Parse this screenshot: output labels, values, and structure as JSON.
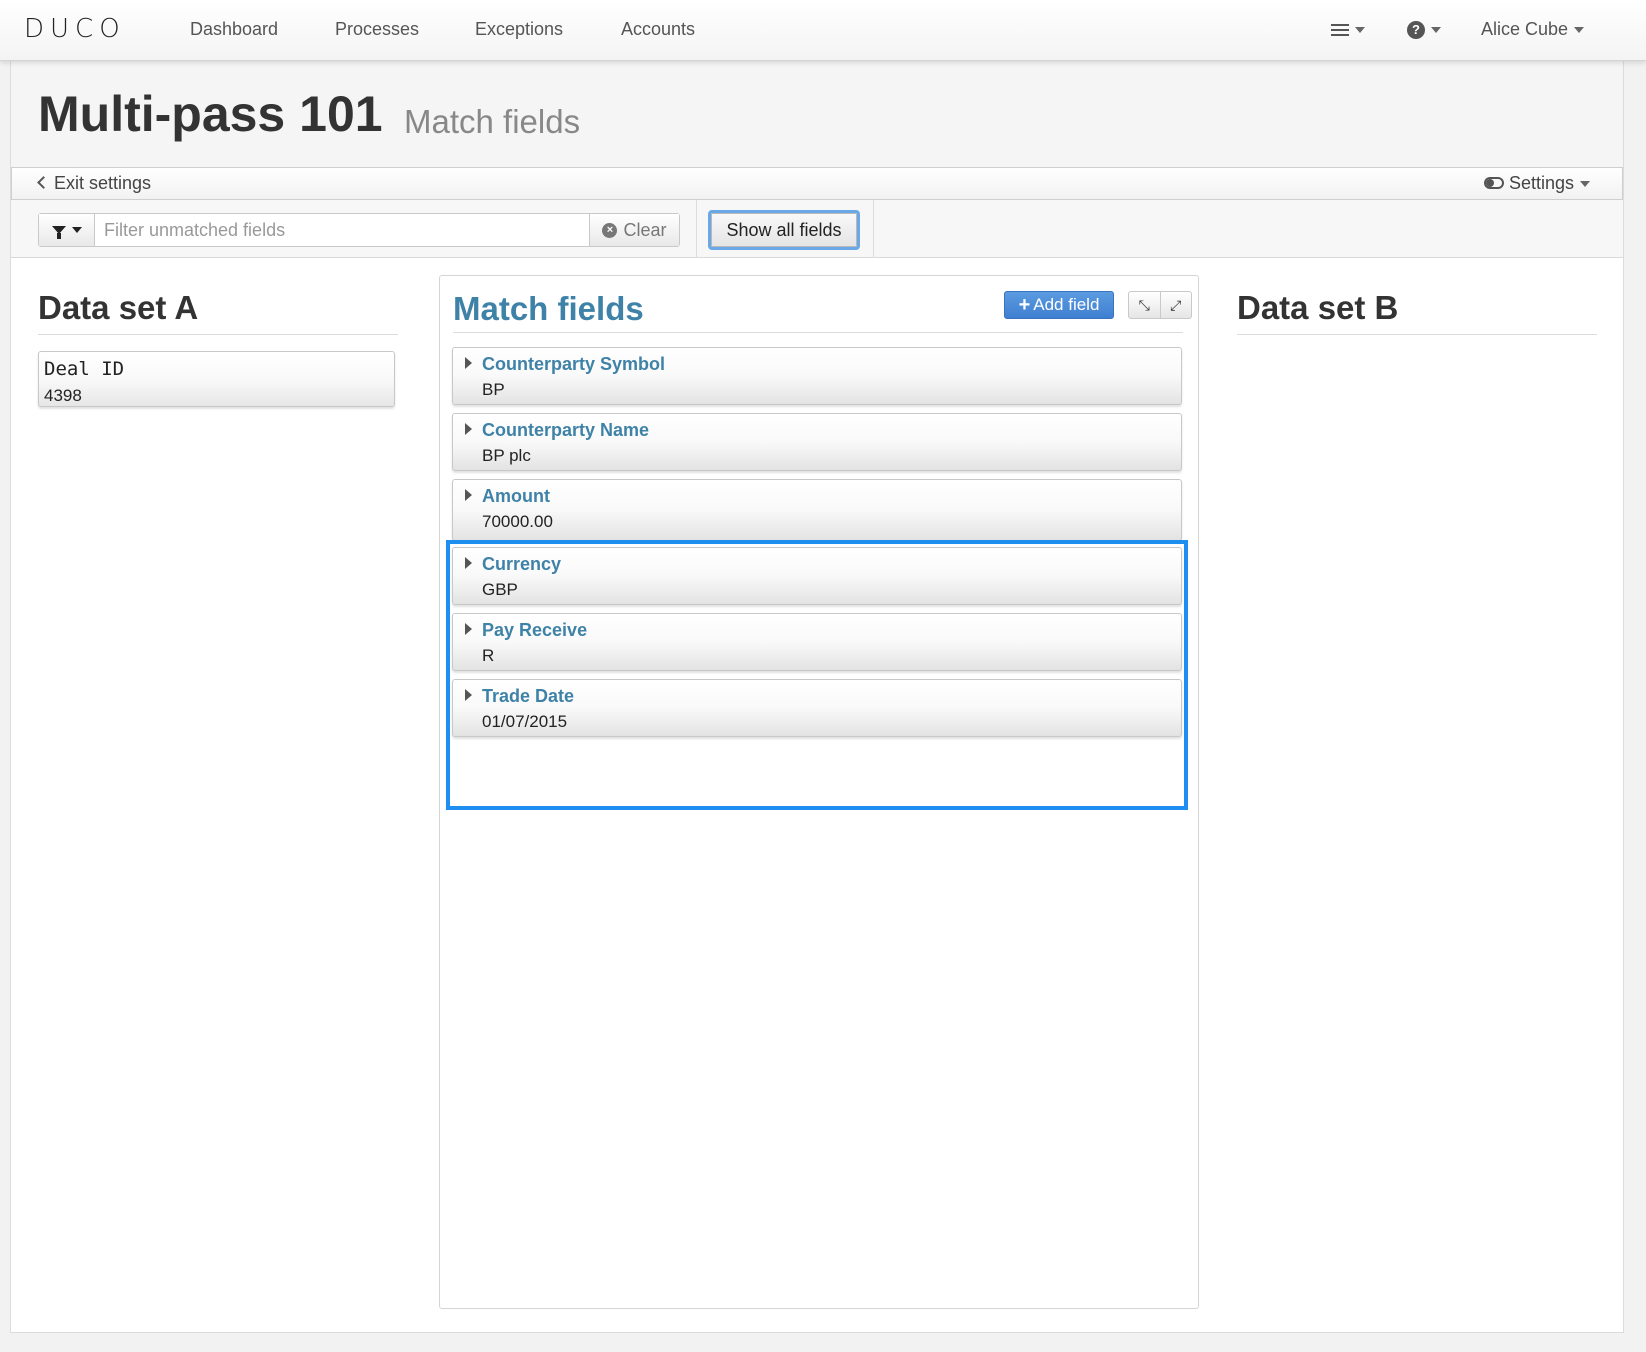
{
  "navbar": {
    "brand": "DUCO",
    "links": [
      "Dashboard",
      "Processes",
      "Exceptions",
      "Accounts"
    ],
    "user": "Alice Cube"
  },
  "header": {
    "title": "Multi-pass 101",
    "subtitle": "Match fields"
  },
  "settings_bar": {
    "exit_label": "Exit settings",
    "settings_label": "Settings"
  },
  "filter": {
    "placeholder": "Filter unmatched fields",
    "clear_label": "Clear",
    "show_all_label": "Show all fields"
  },
  "dataset_a": {
    "title": "Data set A",
    "field": {
      "name": "Deal ID",
      "value": "4398"
    }
  },
  "match": {
    "title": "Match fields",
    "add_label": "Add field",
    "fields": [
      {
        "name": "Counterparty Symbol",
        "value": "BP"
      },
      {
        "name": "Counterparty Name",
        "value": "BP plc"
      },
      {
        "name": "Amount",
        "value": "70000.00"
      },
      {
        "name": "Currency",
        "value": "GBP"
      },
      {
        "name": "Pay Receive",
        "value": "R"
      },
      {
        "name": "Trade Date",
        "value": "01/07/2015"
      }
    ]
  },
  "dataset_b": {
    "title": "Data set B"
  },
  "colors": {
    "accent_blue": "#3f82a8",
    "highlight": "#1e8ef0",
    "primary_button": "#4a8bdb"
  }
}
